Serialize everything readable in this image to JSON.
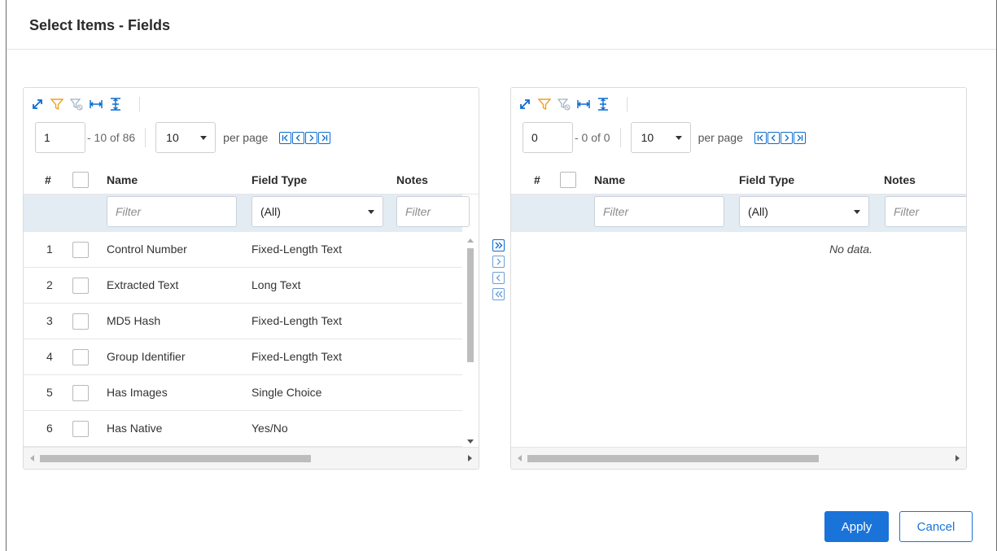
{
  "dialog": {
    "title": "Select Items - Fields"
  },
  "left": {
    "pager": {
      "page": "1",
      "range": "- 10 of 86",
      "page_size": "10",
      "per_page": "per page"
    },
    "columns": {
      "num": "#",
      "name": "Name",
      "type": "Field Type",
      "notes": "Notes"
    },
    "filters": {
      "name_placeholder": "Filter",
      "type_value": "(All)",
      "notes_placeholder": "Filter"
    },
    "rows": [
      {
        "num": "1",
        "name": "Control Number",
        "type": "Fixed-Length Text"
      },
      {
        "num": "2",
        "name": "Extracted Text",
        "type": "Long Text"
      },
      {
        "num": "3",
        "name": "MD5 Hash",
        "type": "Fixed-Length Text"
      },
      {
        "num": "4",
        "name": "Group Identifier",
        "type": "Fixed-Length Text"
      },
      {
        "num": "5",
        "name": "Has Images",
        "type": "Single Choice"
      },
      {
        "num": "6",
        "name": "Has Native",
        "type": "Yes/No"
      }
    ]
  },
  "right": {
    "pager": {
      "page": "0",
      "range": "- 0 of 0",
      "page_size": "10",
      "per_page": "per page"
    },
    "columns": {
      "num": "#",
      "name": "Name",
      "type": "Field Type",
      "notes": "Notes"
    },
    "filters": {
      "name_placeholder": "Filter",
      "type_value": "(All)",
      "notes_placeholder": "Filter"
    },
    "empty_text": "No data."
  },
  "footer": {
    "apply_label": "Apply",
    "cancel_label": "Cancel"
  },
  "colors": {
    "accent": "#1a73d9",
    "filter_bar": "#e3ebf3",
    "toolbar_filter": "#f0a020"
  },
  "icons": [
    "expand-icon",
    "filter-icon",
    "clear-filter-icon",
    "fit-columns-icon",
    "row-height-icon",
    "first-page-icon",
    "prev-page-icon",
    "next-page-icon",
    "last-page-icon",
    "move-all-right-icon",
    "move-right-icon",
    "move-left-icon",
    "move-all-left-icon"
  ]
}
